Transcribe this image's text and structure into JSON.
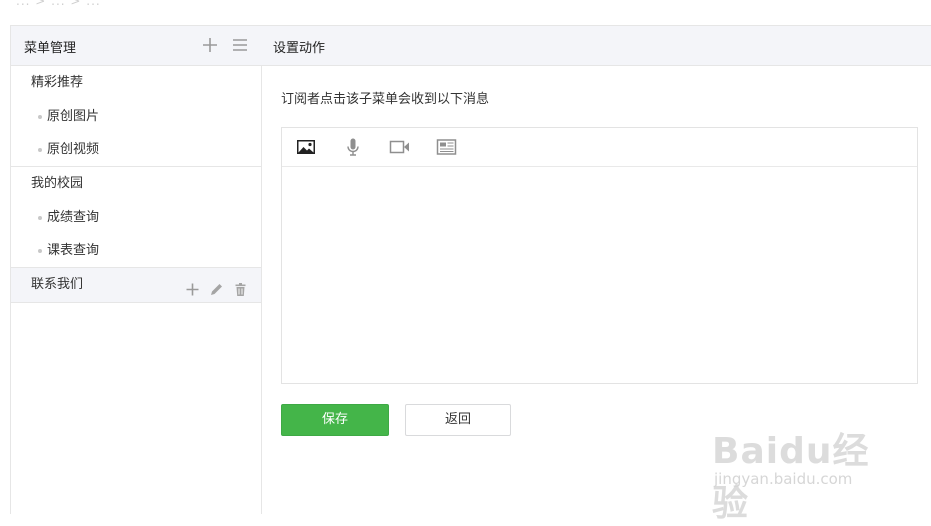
{
  "breadcrumb_faded": "...  >  ...  >  ...",
  "sidebar": {
    "title": "菜单管理",
    "groups": [
      {
        "label": "精彩推荐",
        "children": [
          "原创图片",
          "原创视频"
        ]
      },
      {
        "label": "我的校园",
        "children": [
          "成绩查询",
          "课表查询"
        ]
      },
      {
        "label": "联系我们",
        "children": []
      }
    ],
    "icons": {
      "add": "plus-icon",
      "sort": "list-icon",
      "edit": "pencil-icon",
      "delete": "trash-icon"
    }
  },
  "main": {
    "title": "设置动作",
    "description": "订阅者点击该子菜单会收到以下消息",
    "toolbar_icons": [
      "image-icon",
      "microphone-icon",
      "video-icon",
      "news-icon"
    ],
    "save_label": "保存",
    "back_label": "返回"
  },
  "watermark": {
    "brand": "Baidu经验",
    "url": "jingyan.baidu.com"
  },
  "colors": {
    "accent": "#44b549",
    "header_bg": "#f4f5f9",
    "border": "#e6e6e6"
  }
}
